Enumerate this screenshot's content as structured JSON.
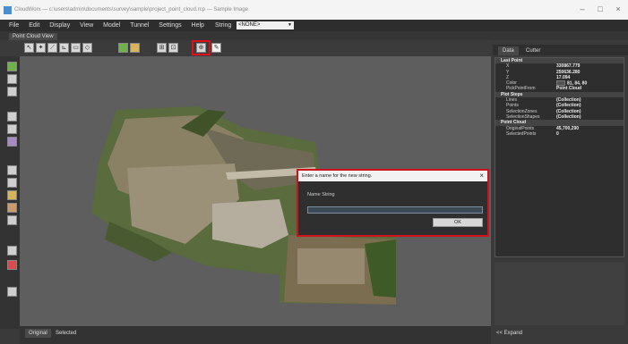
{
  "window": {
    "title": "CloudWorx — c:\\users\\admin\\documents\\survey\\sample\\project_point_cloud.rcp — Sample Image",
    "minimize_glyph": "–",
    "maximize_glyph": "□",
    "close_glyph": "×"
  },
  "menu": {
    "items": [
      "File",
      "Edit",
      "Display",
      "View",
      "Model",
      "Tunnel",
      "Settings",
      "Help"
    ],
    "string_label": "String",
    "string_value": "<NONE>"
  },
  "doc_tab": {
    "label": "Point Cloud View"
  },
  "bottom_tabs": [
    "Original",
    "Selected"
  ],
  "right_panel": {
    "tabs": [
      "Data",
      "Cutter"
    ],
    "properties": [
      {
        "key": "Last Point",
        "value": "",
        "header": true
      },
      {
        "key": "X",
        "value": "330867.779"
      },
      {
        "key": "Y",
        "value": "250636.280"
      },
      {
        "key": "Z",
        "value": "17.094"
      },
      {
        "key": "Color",
        "value": "81, 84, 80",
        "swatch": "#515450"
      },
      {
        "key": "PickPointFrom",
        "value": "Point Cloud"
      },
      {
        "key": "Plot Steps",
        "value": "",
        "header": true
      },
      {
        "key": "Lines",
        "value": "(Collection)"
      },
      {
        "key": "Points",
        "value": "(Collection)"
      },
      {
        "key": "SelectionZones",
        "value": "(Collection)"
      },
      {
        "key": "SelectionShapes",
        "value": "(Collection)"
      },
      {
        "key": "Point Cloud",
        "value": "",
        "header": true
      },
      {
        "key": "OriginalPoints",
        "value": "45,700,290"
      },
      {
        "key": "SelectedPoints",
        "value": "0"
      }
    ],
    "expand_label": "<< Expand"
  },
  "dialog": {
    "title": "Enter a name for the new string.",
    "close_glyph": "×",
    "field_label": "Name String",
    "input_value": "",
    "ok_label": "OK"
  }
}
